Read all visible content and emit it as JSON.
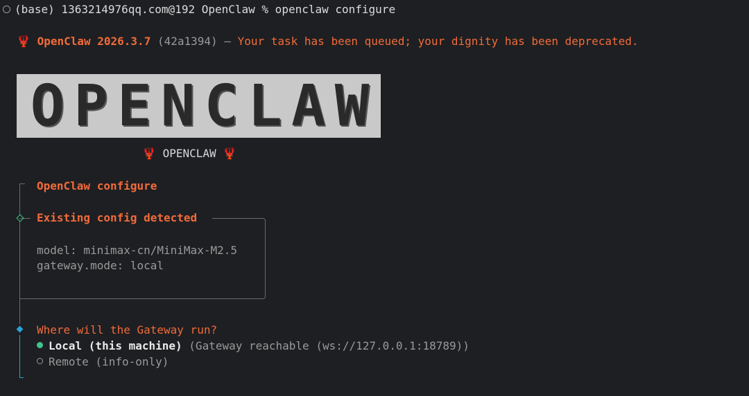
{
  "prompt": {
    "text": "(base) 1363214976qq.com@192 OpenClaw % openclaw configure"
  },
  "banner": {
    "emoji": "🦞",
    "product": "OpenClaw 2026.3.7",
    "commit": "(42a1394)",
    "dash": " — ",
    "tagline": "Your task has been queued; your dignity has been deprecated."
  },
  "logo": {
    "letters": [
      "O",
      "P",
      "E",
      "N",
      "C",
      "L",
      "A",
      "W"
    ],
    "subtitle": "OPENCLAW",
    "subtitle_emoji": "🦞"
  },
  "wizard": {
    "title": "OpenClaw configure",
    "config_section": {
      "heading": "Existing config detected",
      "lines": [
        "model: minimax-cn/MiniMax-M2.5",
        "gateway.mode: local"
      ]
    },
    "question": {
      "text": "Where will the Gateway run?",
      "options": [
        {
          "label": "Local (this machine)",
          "hint": "(Gateway reachable (ws://127.0.0.1:18789))",
          "selected": true
        },
        {
          "label": "Remote (info-only)",
          "hint": "",
          "selected": false
        }
      ]
    }
  },
  "colors": {
    "accent": "#f26b3a",
    "success": "#3fc48a",
    "active_step": "#2aa3d6",
    "background": "#1e1f22"
  }
}
